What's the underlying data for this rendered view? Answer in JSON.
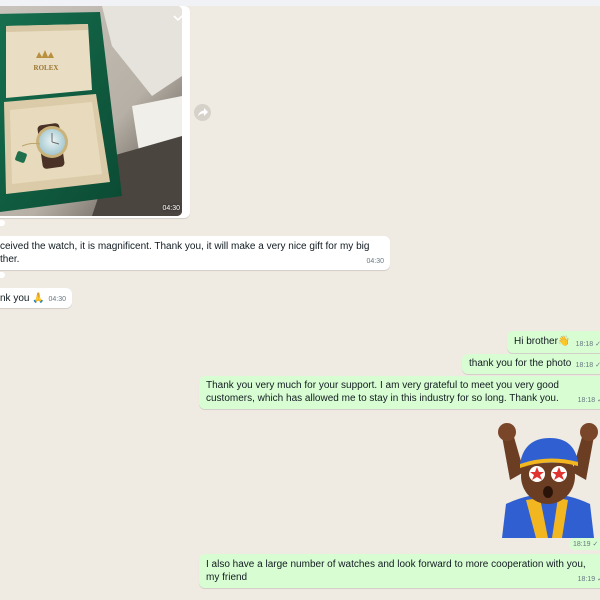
{
  "incoming": {
    "image_message": {
      "time": "04:30",
      "box_brand": "ROLEX"
    },
    "messages": [
      {
        "text": "ceived the watch, it is magnificent. Thank you, it will make a very nice gift for my big ther.",
        "time": "04:30"
      },
      {
        "text": "nk you 🙏",
        "time": "04:30"
      }
    ]
  },
  "outgoing": {
    "messages": [
      {
        "text": "Hi brother👋",
        "time": "18:18"
      },
      {
        "text": "thank you for the photo",
        "time": "18:18"
      },
      {
        "text": "Thank you very much for your support. I am very grateful to meet you very good customers, which has allowed me to stay in this industry for so long. Thank you.",
        "time": "18:18"
      },
      {
        "time": "18:19"
      },
      {
        "text": "I also have a large number of watches and look forward to more cooperation with you, my friend",
        "time": "18:19"
      }
    ]
  },
  "colors": {
    "chat_background": "#efeae2",
    "outgoing_bubble": "#d9fdd3",
    "incoming_bubble": "#ffffff",
    "meta_text": "#667781"
  },
  "icons": {
    "forward": "forward-icon",
    "menu_chevron": "chevron-down-icon",
    "read_status": "check-icon"
  }
}
